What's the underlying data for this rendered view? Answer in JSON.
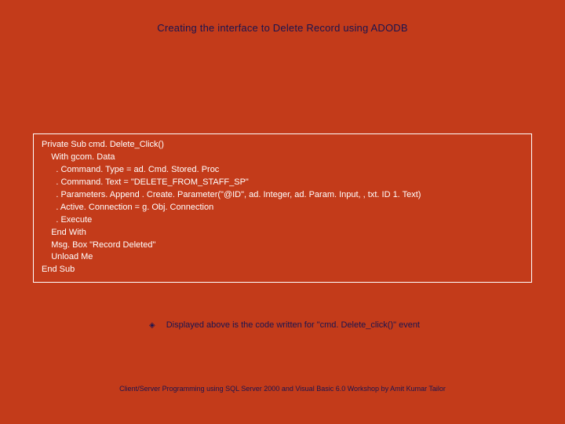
{
  "title": "Creating the interface to Delete Record using ADODB",
  "code": "Private Sub cmd. Delete_Click()\n    With gcom. Data\n      . Command. Type = ad. Cmd. Stored. Proc\n      . Command. Text = \"DELETE_FROM_STAFF_SP\"\n      . Parameters. Append . Create. Parameter(\"@ID\", ad. Integer, ad. Param. Input, , txt. ID 1. Text)\n      . Active. Connection = g. Obj. Connection\n      . Execute\n    End With\n    Msg. Box \"Record Deleted\"\n    Unload Me\nEnd Sub",
  "caption": "Displayed above is the code written for \"cmd. Delete_click()\" event",
  "footer": "Client/Server Programming using SQL Server 2000 and Visual Basic 6.0 Workshop by Amit Kumar Tailor"
}
